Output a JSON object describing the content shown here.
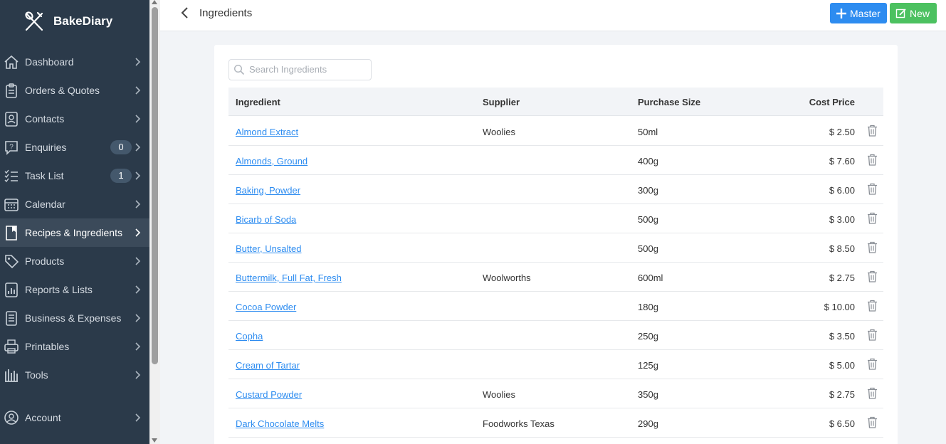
{
  "brand": {
    "name": "BakeDiary"
  },
  "sidebar": {
    "items": [
      {
        "label": "Dashboard",
        "icon": "home-icon"
      },
      {
        "label": "Orders & Quotes",
        "icon": "clipboard-icon"
      },
      {
        "label": "Contacts",
        "icon": "contact-card-icon"
      },
      {
        "label": "Enquiries",
        "icon": "question-bubble-icon",
        "badge": "0"
      },
      {
        "label": "Task List",
        "icon": "checklist-icon",
        "badge": "1"
      },
      {
        "label": "Calendar",
        "icon": "calendar-icon"
      },
      {
        "label": "Recipes & Ingredients",
        "icon": "book-icon",
        "active": true
      },
      {
        "label": "Products",
        "icon": "tag-icon"
      },
      {
        "label": "Reports & Lists",
        "icon": "report-icon"
      },
      {
        "label": "Business & Expenses",
        "icon": "ledger-icon"
      },
      {
        "label": "Printables",
        "icon": "printer-icon"
      },
      {
        "label": "Tools",
        "icon": "tools-icon"
      },
      {
        "label": "Account",
        "icon": "account-icon"
      }
    ]
  },
  "header": {
    "title": "Ingredients",
    "master_label": "Master",
    "new_label": "New"
  },
  "search": {
    "placeholder": "Search Ingredients",
    "value": ""
  },
  "table": {
    "headers": {
      "ingredient": "Ingredient",
      "supplier": "Supplier",
      "size": "Purchase Size",
      "cost": "Cost Price"
    },
    "rows": [
      {
        "ingredient": "Almond Extract",
        "supplier": "Woolies",
        "size": "50ml",
        "cost": "$ 2.50"
      },
      {
        "ingredient": "Almonds, Ground",
        "supplier": "",
        "size": "400g",
        "cost": "$ 7.60"
      },
      {
        "ingredient": "Baking, Powder",
        "supplier": "",
        "size": "300g",
        "cost": "$ 6.00"
      },
      {
        "ingredient": "Bicarb of Soda",
        "supplier": "",
        "size": "500g",
        "cost": "$ 3.00"
      },
      {
        "ingredient": "Butter, Unsalted",
        "supplier": "",
        "size": "500g",
        "cost": "$ 8.50"
      },
      {
        "ingredient": "Buttermilk, Full Fat, Fresh",
        "supplier": "Woolworths",
        "size": "600ml",
        "cost": "$ 2.75"
      },
      {
        "ingredient": "Cocoa Powder",
        "supplier": "",
        "size": "180g",
        "cost": "$ 10.00"
      },
      {
        "ingredient": "Copha",
        "supplier": "",
        "size": "250g",
        "cost": "$ 3.50"
      },
      {
        "ingredient": "Cream of Tartar",
        "supplier": "",
        "size": "125g",
        "cost": "$ 5.00"
      },
      {
        "ingredient": "Custard Powder",
        "supplier": "Woolies",
        "size": "350g",
        "cost": "$ 2.75"
      },
      {
        "ingredient": "Dark Chocolate Melts",
        "supplier": "Foodworks Texas",
        "size": "290g",
        "cost": "$ 6.50"
      }
    ]
  },
  "colors": {
    "sidebar_bg": "#2b3a4a",
    "master_btn": "#2d8cf0",
    "new_btn": "#4cc160",
    "link": "#2d8cf0"
  }
}
